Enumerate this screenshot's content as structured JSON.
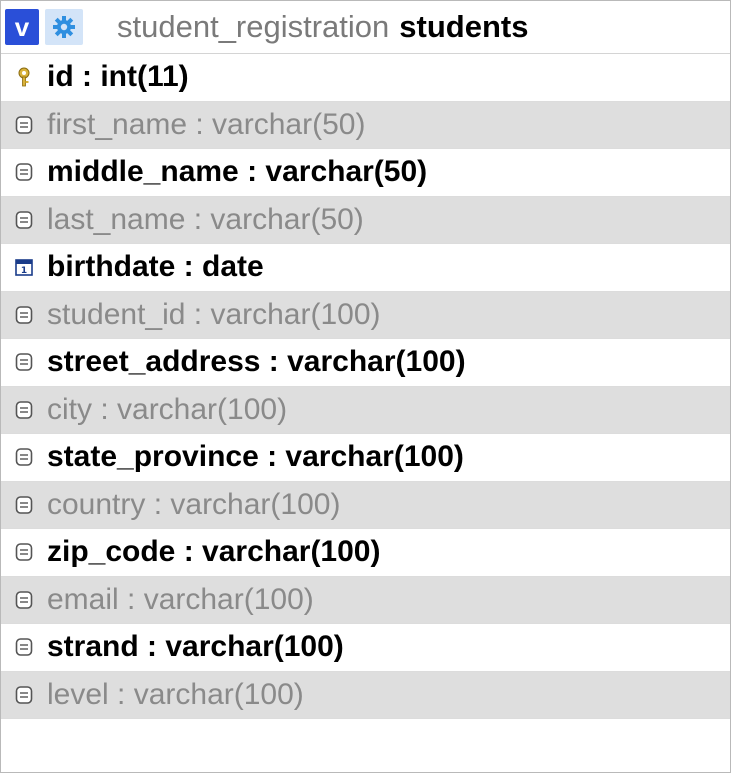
{
  "header": {
    "toggle_label": "v",
    "options_icon": "gear-icon",
    "database": "student_registration",
    "table": "students"
  },
  "columns": [
    {
      "label": "id : int(11)",
      "icon": "primary-key-icon"
    },
    {
      "label": "first_name : varchar(50)",
      "icon": "text-column-icon"
    },
    {
      "label": "middle_name : varchar(50)",
      "icon": "text-column-icon"
    },
    {
      "label": "last_name : varchar(50)",
      "icon": "text-column-icon"
    },
    {
      "label": "birthdate : date",
      "icon": "date-column-icon"
    },
    {
      "label": "student_id : varchar(100)",
      "icon": "text-column-icon"
    },
    {
      "label": "street_address : varchar(100)",
      "icon": "text-column-icon"
    },
    {
      "label": "city : varchar(100)",
      "icon": "text-column-icon"
    },
    {
      "label": "state_province : varchar(100)",
      "icon": "text-column-icon"
    },
    {
      "label": "country : varchar(100)",
      "icon": "text-column-icon"
    },
    {
      "label": "zip_code : varchar(100)",
      "icon": "text-column-icon"
    },
    {
      "label": "email : varchar(100)",
      "icon": "text-column-icon"
    },
    {
      "label": "strand : varchar(100)",
      "icon": "text-column-icon"
    },
    {
      "label": "level : varchar(100)",
      "icon": "text-column-icon"
    }
  ],
  "colors": {
    "toggle_bg": "#2a4fd8",
    "options_bg": "#d3e4f8",
    "odd_row_bg": "#dedede"
  }
}
